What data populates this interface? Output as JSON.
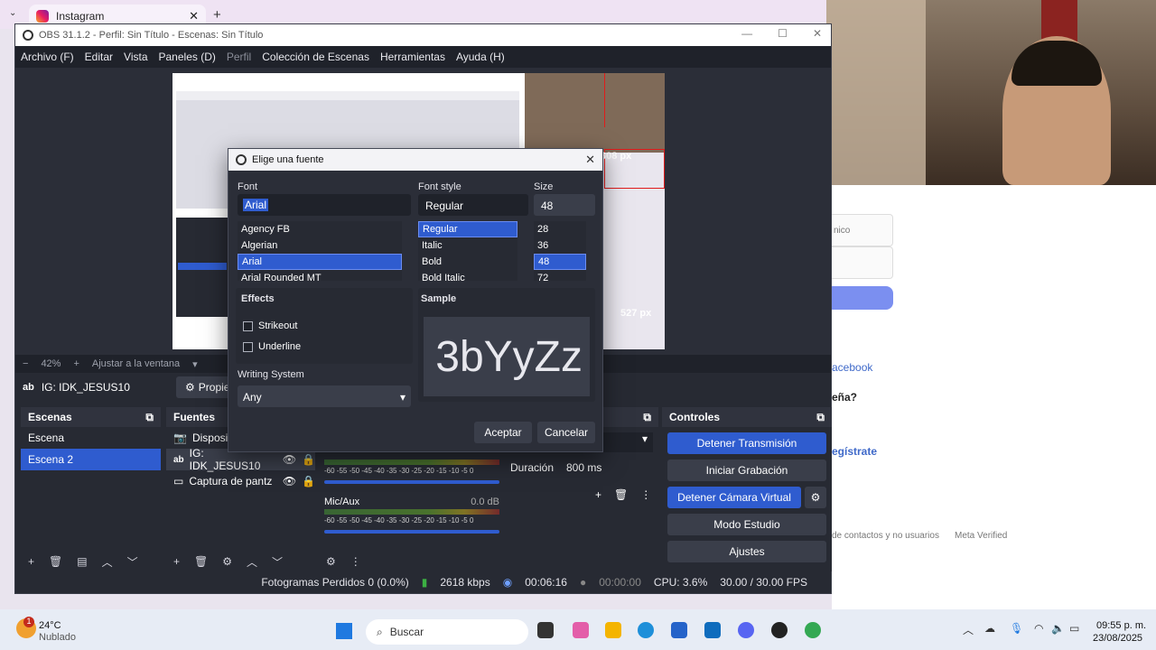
{
  "browser": {
    "tab_title": "Instagram",
    "tab_close": "✕",
    "new_tab": "+",
    "tab_menu": "⌄"
  },
  "obs": {
    "title": "OBS 31.1.2 - Perfil: Sin Título - Escenas: Sin Título",
    "window_btns": [
      "—",
      "☐",
      "✕"
    ],
    "menu": [
      "Archivo (F)",
      "Editar",
      "Vista",
      "Paneles (D)",
      "Perfil",
      "Colección de Escenas",
      "Herramientas",
      "Ayuda (H)"
    ],
    "preview_labels": {
      "height": "308 px",
      "width": "527 px"
    },
    "zoom": {
      "percent": "42%",
      "fit": "Ajustar a la ventana"
    },
    "source_name": "IG: IDK_JESUS10",
    "properties_btn": "Propie",
    "scenes": {
      "title": "Escenas",
      "items": [
        "Escena",
        "Escena 2"
      ],
      "selected": "Escena 2"
    },
    "sources": {
      "title": "Fuentes",
      "items": [
        "Dispositi",
        "IG: IDK_JESUS10",
        "Captura de pantz"
      ]
    },
    "audio": {
      "mic_label": "Mic/Aux",
      "mic_db": "0.0 dB",
      "scale": "-60 -55 -50 -45 -40 -35 -30 -25 -20 -15 -10 -5 0"
    },
    "transition": {
      "title": "cena",
      "duration_label": "Duración",
      "duration_value": "800 ms"
    },
    "controls": {
      "title": "Controles",
      "buttons": [
        "Detener Transmisión",
        "Iniciar Grabación",
        "Detener Cámara Virtual",
        "Modo Estudio",
        "Ajustes"
      ]
    },
    "status": {
      "dropped": "Fotogramas Perdidos 0 (0.0%)",
      "kbps": "2618 kbps",
      "stream_time": "00:06:16",
      "rec_time": "00:00:00",
      "cpu": "CPU: 3.6%",
      "fps": "30.00 / 30.00 FPS"
    }
  },
  "font_dialog": {
    "title": "Elige una fuente",
    "font_label": "Font",
    "font_value": "Arial",
    "fonts": [
      "Agency FB",
      "Algerian",
      "Arial",
      "Arial Rounded MT"
    ],
    "style_label": "Font style",
    "style_value": "Regular",
    "styles": [
      "Regular",
      "Italic",
      "Bold",
      "Bold Italic"
    ],
    "size_label": "Size",
    "size_value": "48",
    "sizes": [
      "28",
      "36",
      "48",
      "72"
    ],
    "effects_label": "Effects",
    "strikeout": "Strikeout",
    "underline": "Underline",
    "sample_label": "Sample",
    "sample_text": "3bYyZz",
    "writing_system_label": "Writing System",
    "writing_system_value": "Any",
    "ok": "Aceptar",
    "cancel": "Cancelar"
  },
  "instagram": {
    "input1": "nico",
    "facebook": "acebook",
    "forgot": "eña?",
    "register": "egístrate",
    "footer1": "de contactos y no usuarios",
    "footer2": "Meta Verified"
  },
  "taskbar": {
    "weather_badge": "1",
    "temp": "24°C",
    "weather": "Nublado",
    "search": "Buscar",
    "time": "09:55 p. m.",
    "date": "23/08/2025"
  }
}
